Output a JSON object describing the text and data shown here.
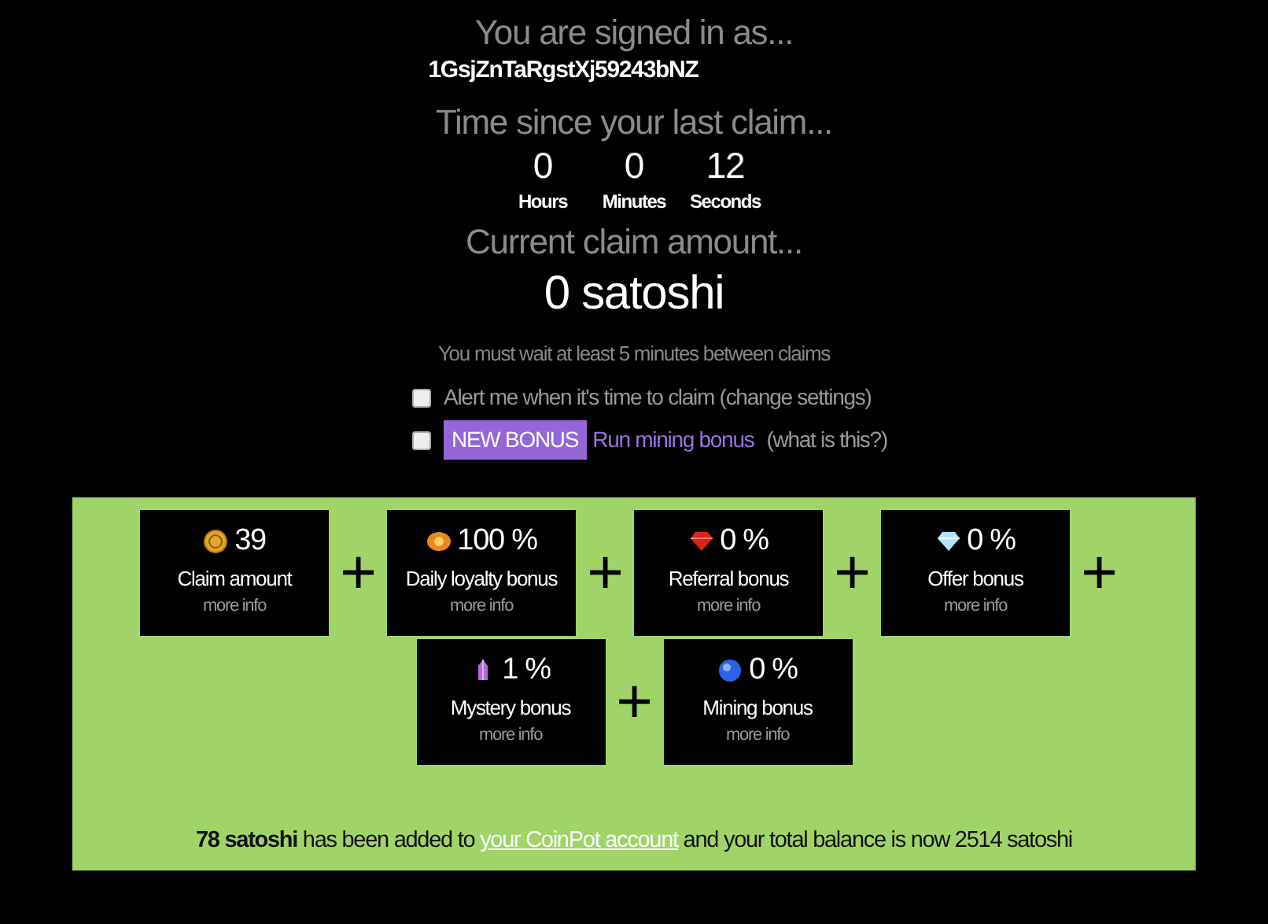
{
  "signed_in": {
    "heading": "You are signed in as...",
    "address": "1GsjZnTaRgstXj59243bNZ"
  },
  "timer": {
    "heading": "Time since your last claim...",
    "units": [
      {
        "value": "0",
        "label": "Hours"
      },
      {
        "value": "0",
        "label": "Minutes"
      },
      {
        "value": "12",
        "label": "Seconds"
      }
    ]
  },
  "claim": {
    "heading": "Current claim amount...",
    "amount": "0 satoshi",
    "note": "You must wait at least 5 minutes between claims"
  },
  "options": [
    {
      "checked": false,
      "label": "Alert me when it's time to claim (change settings)"
    },
    {
      "checked": false,
      "badge": "NEW BONUS",
      "link": "Run mining bonus",
      "label": "(what is this?)"
    }
  ],
  "bonuses": [
    {
      "kind": "coin",
      "value": "39",
      "label": "Claim amount",
      "more": "more info",
      "separator": "+"
    },
    {
      "kind": "sun",
      "value": "100 %",
      "label": "Daily loyalty bonus",
      "more": "more info",
      "separator": "+"
    },
    {
      "kind": "ruby",
      "value": "0 %",
      "label": "Referral bonus",
      "more": "more info",
      "separator": "+"
    },
    {
      "kind": "diamond",
      "value": "0 %",
      "label": "Offer bonus",
      "more": "more info",
      "separator": "+"
    },
    {
      "kind": "crystal",
      "value": "1 %",
      "label": "Mystery bonus",
      "more": "more info",
      "separator": "+"
    },
    {
      "kind": "orb",
      "value": "0 %",
      "label": "Mining bonus",
      "more": "more info"
    }
  ],
  "result": {
    "before": "**78 satoshi** has been added to",
    "link": "your CoinPot account",
    "after": "and your total balance is now 2514 satoshi"
  }
}
